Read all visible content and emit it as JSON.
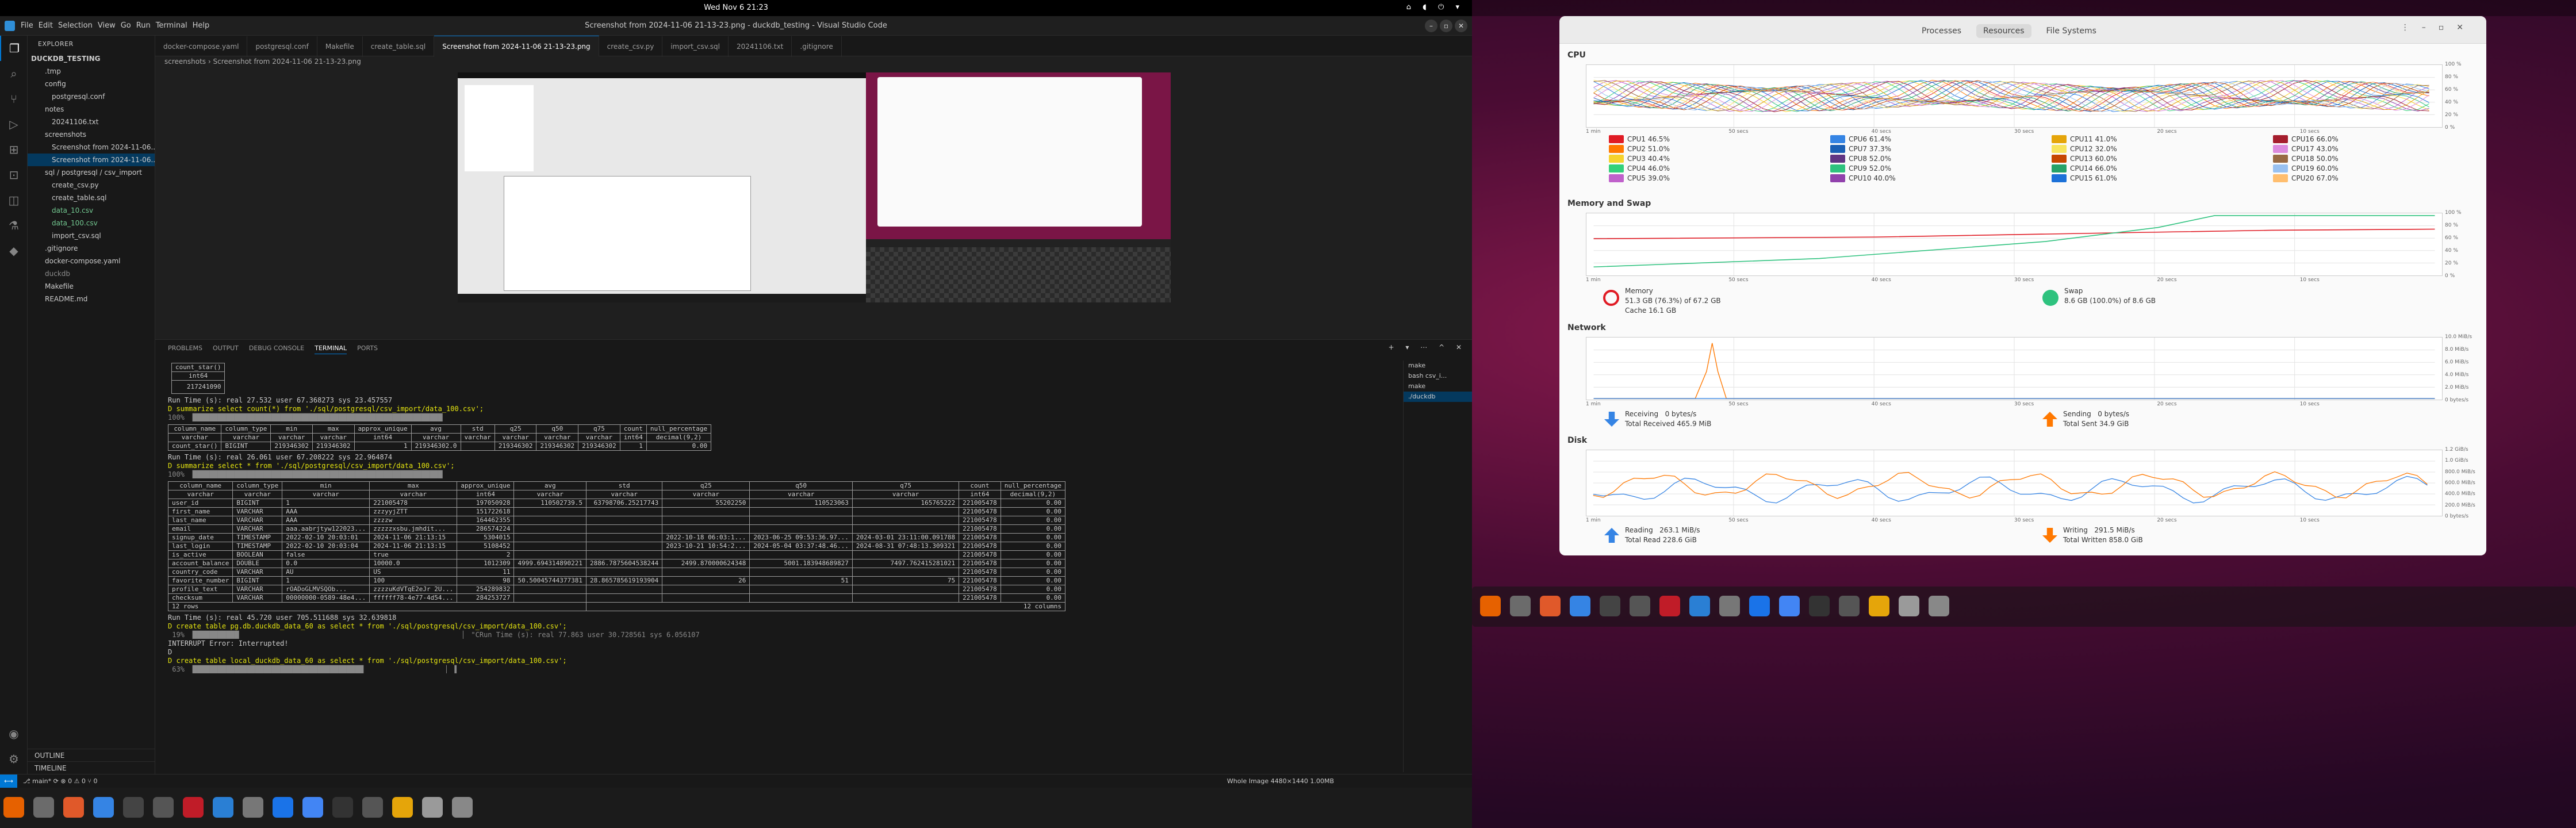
{
  "topbar": {
    "clock": "Wed Nov 6  21:23",
    "tray": "⌂ ◖ ⏻ ▾"
  },
  "vscode": {
    "window_title": "Screenshot from 2024-11-06 21-13-23.png - duckdb_testing - Visual Studio Code",
    "menu": [
      "File",
      "Edit",
      "Selection",
      "View",
      "Go",
      "Run",
      "Terminal",
      "Help"
    ],
    "explorer": {
      "header": "EXPLORER",
      "root": "DUCKDB_TESTING",
      "items": [
        ".tmp",
        "config",
        "postgresql.conf",
        "notes",
        "20241106.txt",
        "screenshots",
        "Screenshot from 2024-11-06...",
        "Screenshot from 2024-11-06...",
        "sql / postgresql / csv_import",
        "create_csv.py",
        "create_table.sql",
        "data_10.csv",
        "data_100.csv",
        "import_csv.sql",
        ".gitignore",
        "docker-compose.yaml",
        "duckdb",
        "Makefile",
        "README.md"
      ],
      "outline": "OUTLINE",
      "timeline": "TIMELINE"
    },
    "tabs": [
      "docker-compose.yaml",
      "postgresql.conf",
      "Makefile",
      "create_table.sql",
      "Screenshot from 2024-11-06 21-13-23.png",
      "create_csv.py",
      "import_csv.sql",
      "20241106.txt",
      ".gitignore"
    ],
    "breadcrumb": "screenshots  ›  Screenshot from 2024-11-06 21-13-23.png",
    "panel_tabs": [
      "PROBLEMS",
      "OUTPUT",
      "DEBUG CONSOLE",
      "TERMINAL",
      "PORTS"
    ],
    "terminal_list": [
      "make",
      "bash  csv_i...",
      "make",
      "./duckdb"
    ],
    "status": {
      "left": "⎇ main*  ⟳  ⊗ 0 ⚠ 0  ⑂ 0",
      "right": "Whole Image    4480×1440    1.00MB"
    },
    "terminal": {
      "count_table": {
        "head1": "count_star()",
        "head2": "int64",
        "value": "217241090"
      },
      "lines": [
        "Run Time (s): real 27.532 user 67.368273 sys 23.457557",
        "D summarize select count(*) from './sql/postgresql/csv_import/data_100.csv';",
        "100% ▕████████████████████████████████████████████████████████████▏",
        "Run Time (s): real 26.061 user 67.208222 sys 22.964874",
        "D summarize select * from './sql/postgresql/csv_import/data_100.csv';",
        "100% ▕████████████████████████████████████████████████████████████▏",
        "Run Time (s): real 45.720 user 705.511688 sys 32.639818",
        "D create table pg.db.duckdb_data_60 as select * from './sql/postgresql/csv_import/data_100.csv';",
        " 19% ▕███████████▏                                                     ▏ \"CRun Time (s): real 77.863 user 30.728561 sys 6.056107",
        "INTERRUPT Error: Interrupted!",
        "D",
        "D create table local_duckdb_data_60 as select * from './sql/postgresql/csv_import/data_100.csv';",
        " 63% ▕█████████████████████████████████████████▏                   ▏ ▌"
      ],
      "summary1": {
        "headers": [
          [
            "column_name",
            "varchar"
          ],
          [
            "column_type",
            "varchar"
          ],
          [
            "min",
            "varchar"
          ],
          [
            "max",
            "varchar"
          ],
          [
            "approx_unique",
            "int64"
          ],
          [
            "avg",
            "varchar"
          ],
          [
            "std",
            "varchar"
          ],
          [
            "q25",
            "varchar"
          ],
          [
            "q50",
            "varchar"
          ],
          [
            "q75",
            "varchar"
          ],
          [
            "count",
            "int64"
          ],
          [
            "null_percentage",
            "decimal(9,2)"
          ]
        ],
        "row": [
          "count_star()",
          "BIGINT",
          "219346302",
          "219346302",
          "1",
          "219346302.0",
          "",
          "219346302",
          "219346302",
          "219346302",
          "1",
          "0.00"
        ]
      },
      "summary2": {
        "headers": [
          [
            "column_name",
            "varchar"
          ],
          [
            "column_type",
            "varchar"
          ],
          [
            "min",
            "varchar"
          ],
          [
            "max",
            "varchar"
          ],
          [
            "approx_unique",
            "int64"
          ],
          [
            "avg",
            "varchar"
          ],
          [
            "std",
            "varchar"
          ],
          [
            "q25",
            "varchar"
          ],
          [
            "q50",
            "varchar"
          ],
          [
            "q75",
            "varchar"
          ],
          [
            "count",
            "int64"
          ],
          [
            "null_percentage",
            "decimal(9,2)"
          ]
        ],
        "rows": [
          [
            "user_id",
            "BIGINT",
            "1",
            "221005478",
            "197050928",
            "110502739.5",
            "63798706.25217743",
            "55202250",
            "110523063",
            "165765222",
            "221005478",
            "0.00"
          ],
          [
            "first_name",
            "VARCHAR",
            "AAA",
            "zzzyyjZTT",
            "151722618",
            "",
            "",
            "",
            "",
            "",
            "221005478",
            "0.00"
          ],
          [
            "last_name",
            "VARCHAR",
            "AAA",
            "zzzzw",
            "164462355",
            "",
            "",
            "",
            "",
            "",
            "221005478",
            "0.00"
          ],
          [
            "email",
            "VARCHAR",
            "aaa.aabrjtyw122023...",
            "zzzzzxsbu.jmhdit...",
            "286574224",
            "",
            "",
            "",
            "",
            "",
            "221005478",
            "0.00"
          ],
          [
            "signup_date",
            "TIMESTAMP",
            "2022-02-10 20:03:01",
            "2024-11-06 21:13:15",
            "5304015",
            "",
            "",
            "2022-10-18 06:03:1...",
            "2023-06-25 09:53:36.97...",
            "2024-03-01 23:11:00.091788",
            "221005478",
            "0.00"
          ],
          [
            "last_login",
            "TIMESTAMP",
            "2022-02-10 20:03:04",
            "2024-11-06 21:13:15",
            "5108452",
            "",
            "",
            "2023-10-21 10:54:2...",
            "2024-05-04 03:37:48.46...",
            "2024-08-31 07:48:13.309321",
            "221005478",
            "0.00"
          ],
          [
            "is_active",
            "BOOLEAN",
            "false",
            "true",
            "2",
            "",
            "",
            "",
            "",
            "",
            "221005478",
            "0.00"
          ],
          [
            "account_balance",
            "DOUBLE",
            "0.0",
            "10000.0",
            "1012309",
            "4999.694314890221",
            "2886.7875604538244",
            "2499.870000624348",
            "5001.183948689827",
            "7497.762415281021",
            "221005478",
            "0.00"
          ],
          [
            "country_code",
            "VARCHAR",
            "AU",
            "US",
            "11",
            "",
            "",
            "",
            "",
            "",
            "221005478",
            "0.00"
          ],
          [
            "favorite_number",
            "BIGINT",
            "1",
            "100",
            "98",
            "50.50045744377381",
            "28.865785619193904",
            "26",
            "51",
            "75",
            "221005478",
            "0.00"
          ],
          [
            "profile_text",
            "VARCHAR",
            "rOADoGLMVSQOb...",
            "zzzzuKdVTqE2eJr 2U...",
            "254289832",
            "",
            "",
            "",
            "",
            "",
            "221005478",
            "0.00"
          ],
          [
            "checksum",
            "VARCHAR",
            "00000000-0589-48e4...",
            "ffffff78-4e77-4d54...",
            "284253727",
            "",
            "",
            "",
            "",
            "",
            "221005478",
            "0.00"
          ]
        ],
        "footer_left": "12 rows",
        "footer_right": "12 columns"
      }
    }
  },
  "system_monitor": {
    "tabs": [
      "Processes",
      "Resources",
      "File Systems"
    ],
    "cpu": {
      "title": "CPU",
      "yticks": [
        "100 %",
        "80 %",
        "60 %",
        "40 %",
        "20 %",
        "0 %"
      ],
      "legend": [
        {
          "label": "CPU1  46.5%",
          "color": "#e01b24"
        },
        {
          "label": "CPU2  51.0%",
          "color": "#ff7800"
        },
        {
          "label": "CPU3  40.4%",
          "color": "#f6d32d"
        },
        {
          "label": "CPU4  46.0%",
          "color": "#33d17a"
        },
        {
          "label": "CPU5  39.0%",
          "color": "#c061cb"
        },
        {
          "label": "CPU6  61.4%",
          "color": "#3584e4"
        },
        {
          "label": "CPU7  37.3%",
          "color": "#1a5fb4"
        },
        {
          "label": "CPU8  52.0%",
          "color": "#613583"
        },
        {
          "label": "CPU9  52.0%",
          "color": "#2ec27e"
        },
        {
          "label": "CPU10  40.0%",
          "color": "#9141ac"
        },
        {
          "label": "CPU11  41.0%",
          "color": "#e5a50a"
        },
        {
          "label": "CPU12  32.0%",
          "color": "#f8e45c"
        },
        {
          "label": "CPU13  60.0%",
          "color": "#c64600"
        },
        {
          "label": "CPU14  66.0%",
          "color": "#26a269"
        },
        {
          "label": "CPU15  61.0%",
          "color": "#1c71d8"
        },
        {
          "label": "CPU16  66.0%",
          "color": "#a51d2d"
        },
        {
          "label": "CPU17  43.0%",
          "color": "#dc8add"
        },
        {
          "label": "CPU18  50.0%",
          "color": "#986a44"
        },
        {
          "label": "CPU19  60.0%",
          "color": "#99c1f1"
        },
        {
          "label": "CPU20  67.0%",
          "color": "#ffbe6f"
        }
      ]
    },
    "xticks": [
      "1 min",
      "50 secs",
      "40 secs",
      "30 secs",
      "20 secs",
      "10 secs"
    ],
    "memory": {
      "title": "Memory and Swap",
      "yticks": [
        "100 %",
        "80 %",
        "60 %",
        "40 %",
        "20 %",
        "0 %"
      ],
      "mem_label": "Memory",
      "mem_value": "51.3 GB (76.3%) of 67.2 GB",
      "cache": "Cache 16.1 GB",
      "swap_label": "Swap",
      "swap_value": "8.6 GB (100.0%) of 8.6 GB",
      "mem_color": "#e01b24",
      "swap_color": "#2ec27e"
    },
    "network": {
      "title": "Network",
      "yticks": [
        "10.0 MiB/s",
        "8.0 MiB/s",
        "6.0 MiB/s",
        "4.0 MiB/s",
        "2.0 MiB/s",
        "0 bytes/s"
      ],
      "recv_label": "Receiving",
      "recv_value": "0 bytes/s",
      "recv_total": "Total Received  465.9 MiB",
      "send_label": "Sending",
      "send_value": "0 bytes/s",
      "send_total": "Total Sent  34.9 GiB"
    },
    "disk": {
      "title": "Disk",
      "yticks": [
        "1.2 GiB/s",
        "1.0 GiB/s",
        "800.0 MiB/s",
        "600.0 MiB/s",
        "400.0 MiB/s",
        "200.0 MiB/s",
        "0 bytes/s"
      ],
      "read_label": "Reading",
      "read_value": "263.1 MiB/s",
      "read_total": "Total Read  228.6 GiB",
      "write_label": "Writing",
      "write_value": "291.5 MiB/s",
      "write_total": "Total Written  858.0 GiB"
    }
  }
}
